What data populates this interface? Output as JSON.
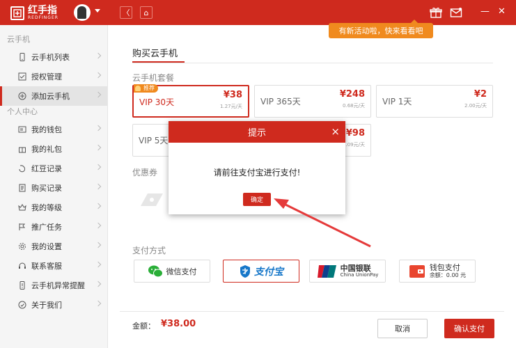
{
  "app": {
    "logo_text": "红手指",
    "logo_sub": "REDFINGER"
  },
  "topbar": {
    "back_glyph": "〈",
    "home_glyph": "⌂",
    "minimize_glyph": "—",
    "close_glyph": "✕"
  },
  "tooltip": {
    "text": "有新活动啦，快来看看吧"
  },
  "sidebar": {
    "group1": "云手机",
    "group1_items": [
      {
        "label": "云手机列表",
        "icon": "phone-icon"
      },
      {
        "label": "授权管理",
        "icon": "auth-icon"
      },
      {
        "label": "添加云手机",
        "icon": "plus-icon"
      }
    ],
    "group2": "个人中心",
    "group2_items": [
      {
        "label": "我的钱包",
        "icon": "wallet-icon"
      },
      {
        "label": "我的礼包",
        "icon": "gift-icon"
      },
      {
        "label": "红豆记录",
        "icon": "bean-icon"
      },
      {
        "label": "购买记录",
        "icon": "record-icon"
      },
      {
        "label": "我的等级",
        "icon": "crown-icon"
      },
      {
        "label": "推广任务",
        "icon": "flag-icon"
      },
      {
        "label": "我的设置",
        "icon": "gear-icon"
      },
      {
        "label": "联系客服",
        "icon": "headset-icon"
      },
      {
        "label": "云手机异常提醒",
        "icon": "alert-icon"
      },
      {
        "label": "关于我们",
        "icon": "info-icon"
      }
    ]
  },
  "main": {
    "title": "购买云手机",
    "packages_title": "云手机套餐",
    "packages": [
      {
        "name": "VIP 30天",
        "price": "¥38",
        "unit": "1.27元/天",
        "badge": "推荐"
      },
      {
        "name": "VIP 365天",
        "price": "¥248",
        "unit": "0.68元/天"
      },
      {
        "name": "VIP 1天",
        "price": "¥2",
        "unit": "2.00元/天"
      },
      {
        "name": "VIP 5天",
        "price": "¥98",
        "unit": "3.09元/天"
      }
    ],
    "coupon_title": "优惠券",
    "payment_title": "支付方式",
    "payments": [
      {
        "label": "微信支付",
        "icon": "wechat-icon"
      },
      {
        "label": "支付宝",
        "icon": "alipay-icon"
      },
      {
        "label": "中国银联",
        "sub": "China UnionPay",
        "icon": "unionpay-icon"
      },
      {
        "label": "钱包支付",
        "sub": "余额：0.00 元",
        "icon": "wallet-pay-icon"
      }
    ],
    "amount_label": "金额：",
    "amount_value": "¥38.00",
    "cancel_label": "取消",
    "pay_label": "确认支付"
  },
  "modal": {
    "title": "提示",
    "close_glyph": "×",
    "message": "请前往支付宝进行支付!",
    "ok_label": "确定"
  },
  "colors": {
    "brand": "#cf2a1e",
    "orange": "#f08a1e"
  }
}
